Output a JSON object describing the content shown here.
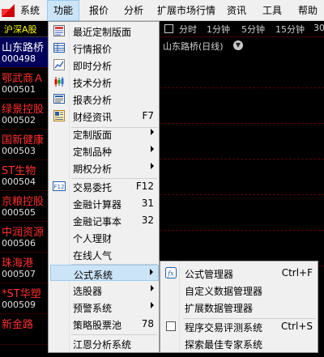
{
  "menubar": {
    "items": [
      "系统",
      "功能",
      "报价",
      "分析",
      "扩展市场行情",
      "资讯",
      "工具",
      "帮助"
    ],
    "active": "功能"
  },
  "stocklist": {
    "header": "沪深A股",
    "rows": [
      {
        "name": "山东路桥",
        "code": "000498",
        "selected": true
      },
      {
        "name": "鄂武商Ａ",
        "code": "000501"
      },
      {
        "name": "绿景控股",
        "code": "000502"
      },
      {
        "name": "国新健康",
        "code": "000503"
      },
      {
        "name": "ST生物",
        "code": "000504"
      },
      {
        "name": "京粮控股",
        "code": "000505"
      },
      {
        "name": "中润资源",
        "code": "000506"
      },
      {
        "name": "珠海港",
        "code": "000507"
      },
      {
        "name": "*ST华塑",
        "code": "000509"
      },
      {
        "name": "新金路",
        "code": ""
      }
    ]
  },
  "chart": {
    "periods": [
      "分时",
      "1分钟",
      "5分钟",
      "15分钟",
      "30"
    ],
    "title": "山东路桥(日线)"
  },
  "menu": {
    "items": [
      {
        "label": "最近定制版面",
        "icon": "recent-layout-icon"
      },
      {
        "label": "行情报价",
        "icon": "quote-table-icon"
      },
      {
        "label": "即时分析",
        "icon": "line-chart-icon"
      },
      {
        "label": "技术分析",
        "icon": "candlestick-icon"
      },
      {
        "label": "报表分析",
        "icon": "report-icon"
      },
      {
        "label": "财经资讯",
        "shortcut": "F7",
        "icon": "news-icon"
      },
      {
        "label": "定制版面",
        "submenu": true
      },
      {
        "label": "定制品种",
        "submenu": true
      },
      {
        "label": "期权分析",
        "submenu": true
      },
      {
        "label": "交易委托",
        "shortcut": "F12",
        "icon": "f12-icon"
      },
      {
        "label": "金融计算器",
        "shortcut": "31"
      },
      {
        "label": "金融记事本",
        "shortcut": "32"
      },
      {
        "label": "个人理财"
      },
      {
        "label": "在线人气"
      },
      {
        "label": "公式系统",
        "submenu": true,
        "highlight": true
      },
      {
        "label": "选股器",
        "submenu": true
      },
      {
        "label": "预警系统",
        "submenu": true
      },
      {
        "label": "策略股票池",
        "shortcut": "78"
      },
      {
        "label": "江恩分析系统"
      }
    ]
  },
  "submenu": {
    "items": [
      {
        "label": "公式管理器",
        "shortcut": "Ctrl+F",
        "icon": "formula-icon"
      },
      {
        "label": "自定义数据管理器"
      },
      {
        "label": "扩展数据管理器"
      },
      {
        "label": "程序交易评测系统",
        "shortcut": "Ctrl+S",
        "icon": "checkbox-icon"
      },
      {
        "label": "探索最佳专家系统"
      }
    ]
  }
}
